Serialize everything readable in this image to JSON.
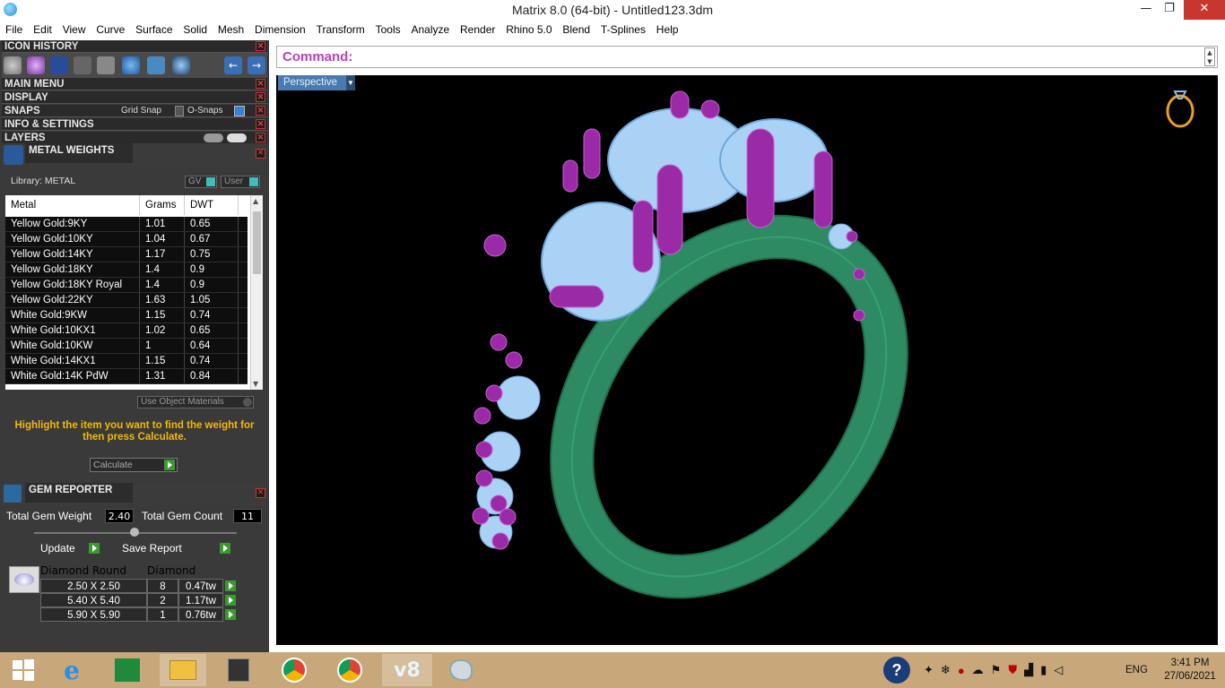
{
  "window": {
    "title": "Matrix 8.0 (64-bit) - Untitled123.3dm"
  },
  "menu": [
    "File",
    "Edit",
    "View",
    "Curve",
    "Surface",
    "Solid",
    "Mesh",
    "Dimension",
    "Transform",
    "Tools",
    "Analyze",
    "Render",
    "Rhino 5.0",
    "Blend",
    "T-Splines",
    "Help"
  ],
  "panels": {
    "icon_history": "ICON HISTORY",
    "main_menu": "MAIN MENU",
    "display": "DISPLAY",
    "snaps": "SNAPS",
    "grid_snap": "Grid Snap",
    "o_snaps": "O-Snaps",
    "info_settings": "INFO & SETTINGS",
    "layers": "LAYERS"
  },
  "metal_weights": {
    "title": "METAL WEIGHTS",
    "library": "Library: METAL",
    "gv": "GV",
    "user": "User",
    "columns": [
      "Metal",
      "Grams",
      "DWT"
    ],
    "rows": [
      [
        "Yellow Gold:9KY",
        "1.01",
        "0.65"
      ],
      [
        "Yellow Gold:10KY",
        "1.04",
        "0.67"
      ],
      [
        "Yellow Gold:14KY",
        "1.17",
        "0.75"
      ],
      [
        "Yellow Gold:18KY",
        "1.4",
        "0.9"
      ],
      [
        "Yellow Gold:18KY Royal",
        "1.4",
        "0.9"
      ],
      [
        "Yellow Gold:22KY",
        "1.63",
        "1.05"
      ],
      [
        "White Gold:9KW",
        "1.15",
        "0.74"
      ],
      [
        "White Gold:10KX1",
        "1.02",
        "0.65"
      ],
      [
        "White Gold:10KW",
        "1",
        "0.64"
      ],
      [
        "White Gold:14KX1",
        "1.15",
        "0.74"
      ],
      [
        "White Gold:14K PdW",
        "1.31",
        "0.84"
      ]
    ],
    "use_object_materials": "Use Object Materials",
    "hint": "Highlight the item you want to find the weight for then press Calculate.",
    "calculate": "Calculate"
  },
  "gem_reporter": {
    "title": "GEM REPORTER",
    "total_weight_label": "Total Gem Weight",
    "total_weight": "2.40",
    "total_count_label": "Total Gem Count",
    "total_count": "11",
    "update": "Update",
    "save_report": "Save Report",
    "col_shape": "Diamond Round",
    "col_type": "Diamond",
    "rows": [
      [
        "2.50 X 2.50",
        "8",
        "0.47tw"
      ],
      [
        "5.40 X 5.40",
        "2",
        "1.17tw"
      ],
      [
        "5.90 X 5.90",
        "1",
        "0.76tw"
      ]
    ]
  },
  "command": {
    "label": "Command:",
    "value": ""
  },
  "viewport": {
    "name": "Perspective"
  },
  "colors": {
    "band": "#2e8a62",
    "gems": "#a9d2f5",
    "prongs": "#9a2aa6",
    "accent": "#c03cc0"
  },
  "tray": {
    "lang": "ENG",
    "time": "3:41 PM",
    "date": "27/06/2021"
  }
}
